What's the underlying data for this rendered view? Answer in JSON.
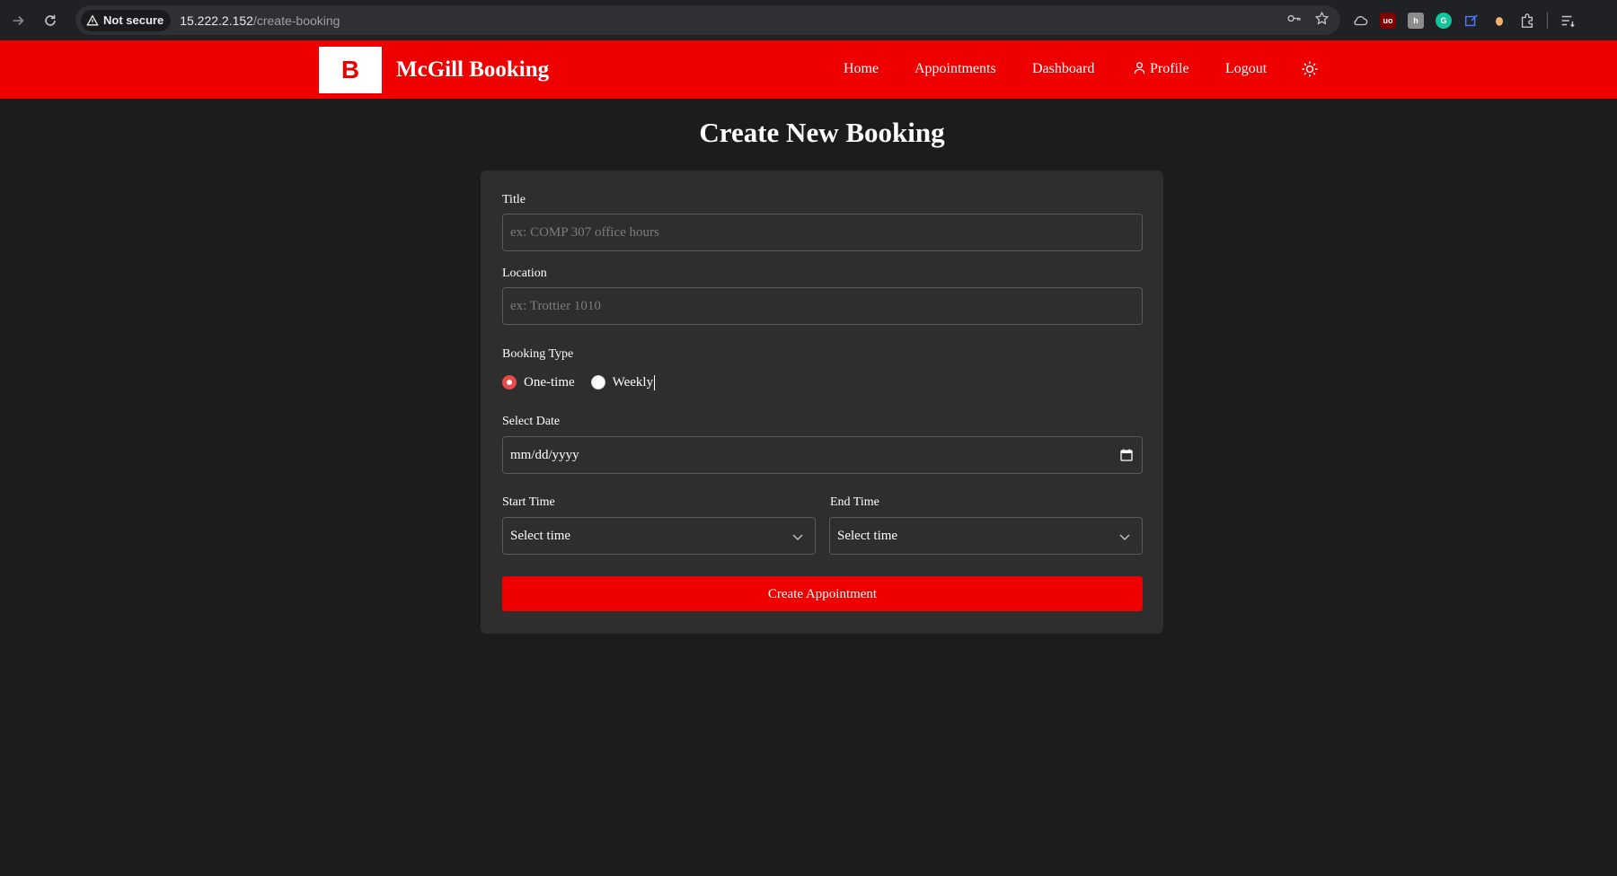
{
  "browser": {
    "security_label": "Not secure",
    "url_host": "15.222.2.152",
    "url_path": "/create-booking",
    "icons": [
      "back-arrow-icon",
      "reload-icon",
      "key-icon",
      "star-icon",
      "extensions-icon",
      "reading-list-icon"
    ]
  },
  "nav": {
    "logo_letter": "B",
    "brand": "McGill Booking",
    "links": {
      "home": "Home",
      "appointments": "Appointments",
      "dashboard": "Dashboard",
      "profile": "Profile",
      "logout": "Logout"
    },
    "theme_icon": "sun-icon"
  },
  "page": {
    "title": "Create New Booking"
  },
  "form": {
    "title_label": "Title",
    "title_placeholder": "ex: COMP 307 office hours",
    "title_value": "",
    "location_label": "Location",
    "location_placeholder": "ex: Trottier 1010",
    "location_value": "",
    "booking_type_label": "Booking Type",
    "booking_types": [
      {
        "label": "One-time",
        "selected": true
      },
      {
        "label": "Weekly",
        "selected": false
      }
    ],
    "date_label": "Select Date",
    "date_value": "mm/dd/yyyy",
    "start_time_label": "Start Time",
    "start_time_value": "Select time",
    "end_time_label": "End Time",
    "end_time_value": "Select time",
    "submit_label": "Create Appointment"
  },
  "colors": {
    "brand_red": "#ee0000",
    "background": "#1c1c1c",
    "card": "#2e2e2e",
    "radio_accent": "#e84a4a"
  }
}
